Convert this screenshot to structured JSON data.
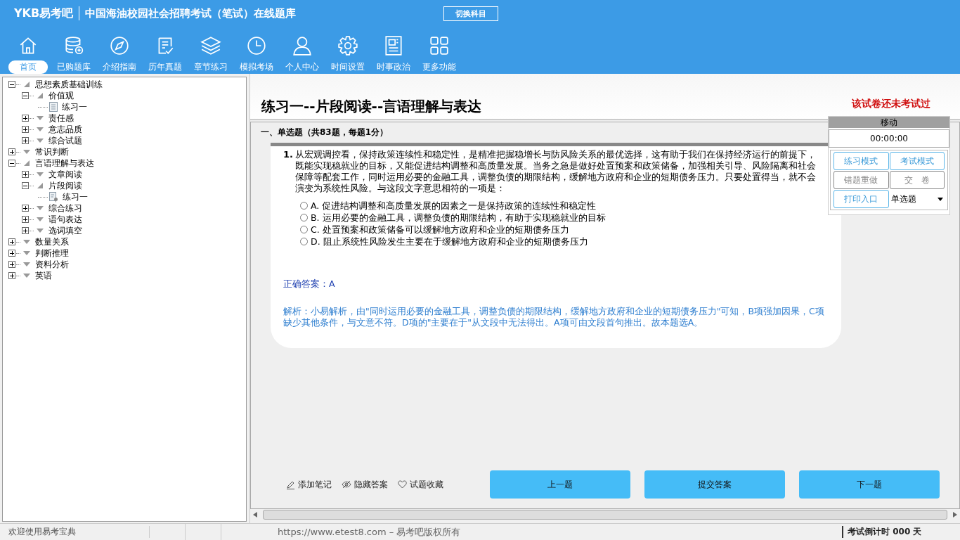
{
  "header": {
    "logo": "YKB易考吧",
    "title": "中国海油校园社会招聘考试（笔试）在线题库",
    "switch_button": "切换科目"
  },
  "nav": [
    {
      "label": "首页",
      "selected": true
    },
    {
      "label": "已购题库",
      "selected": false
    },
    {
      "label": "介绍指南",
      "selected": false
    },
    {
      "label": "历年真题",
      "selected": false
    },
    {
      "label": "章节练习",
      "selected": false
    },
    {
      "label": "模拟考场",
      "selected": false
    },
    {
      "label": "个人中心",
      "selected": false
    },
    {
      "label": "时间设置",
      "selected": false
    },
    {
      "label": "时事政治",
      "selected": false
    },
    {
      "label": "更多功能",
      "selected": false
    }
  ],
  "tree": [
    {
      "label": "思想素质基础训练",
      "expanded": true,
      "children": [
        {
          "label": "价值观",
          "expanded": true,
          "children": [
            {
              "label": "练习一",
              "kind": "doc"
            }
          ]
        },
        {
          "label": "责任感",
          "expanded": false
        },
        {
          "label": "意志品质",
          "expanded": false
        },
        {
          "label": "综合试题",
          "expanded": false
        }
      ]
    },
    {
      "label": "常识判断",
      "expanded": false
    },
    {
      "label": "言语理解与表达",
      "expanded": true,
      "children": [
        {
          "label": "文章阅读",
          "expanded": false
        },
        {
          "label": "片段阅读",
          "expanded": true,
          "children": [
            {
              "label": "练习一",
              "kind": "doc-marked"
            }
          ]
        },
        {
          "label": "综合练习",
          "expanded": false
        },
        {
          "label": "语句表达",
          "expanded": false
        },
        {
          "label": "选词填空",
          "expanded": false
        }
      ]
    },
    {
      "label": "数量关系",
      "expanded": false
    },
    {
      "label": "判断推理",
      "expanded": false
    },
    {
      "label": "资料分析",
      "expanded": false
    },
    {
      "label": "英语",
      "expanded": false
    }
  ],
  "paper": {
    "title": "练习一--片段阅读--言语理解与表达",
    "status": "该试卷还未考试过",
    "section": "一、单选题（共83题，每题1分）"
  },
  "question": {
    "number": "1.",
    "text": "从宏观调控看，保持政策连续性和稳定性，是精准把握稳增长与防风险关系的最优选择，这有助于我们在保持经济运行的前提下，既能实现稳就业的目标，又能促进结构调整和高质量发展。当务之急是做好处置预案和政策储备，加强相关引导、风险隔离和社会保障等配套工作，同时运用必要的金融工具，调整负债的期限结构，缓解地方政府和企业的短期债务压力。只要处置得当，就不会演变为系统性风险。与这段文字意思相符的一项是：",
    "options": [
      {
        "text": "A. 促进结构调整和高质量发展的因素之一是保持政策的连续性和稳定性",
        "selected": false
      },
      {
        "text": "B. 运用必要的金融工具，调整负债的期限结构，有助于实现稳就业的目标",
        "selected": false
      },
      {
        "text": "C. 处置预案和政策储备可以缓解地方政府和企业的短期债务压力",
        "selected": false
      },
      {
        "text": "D. 阻止系统性风险发生主要在于缓解地方政府和企业的短期债务压力",
        "selected": false
      }
    ],
    "answer": "正确答案：A",
    "analysis": "解析：小易解析，由\"同时运用必要的金融工具，调整负债的期限结构，缓解地方政府和企业的短期债务压力\"可知，B项强加因果，C项缺少其他条件，与文意不符。D项的\"主要在于\"从文段中无法得出。A项可由文段首句推出。故本题选A。"
  },
  "tools": [
    "添加笔记",
    "隐藏答案",
    "试题收藏"
  ],
  "buttons": [
    "上一题",
    "提交答案",
    "下一题"
  ],
  "panel": {
    "title": "移动",
    "timer": "00:00:00",
    "buttons": [
      "练习模式",
      "考试模式",
      "错题重做",
      "交　卷",
      "打印入口"
    ],
    "select": "单选题"
  },
  "status_bar": {
    "welcome": "欢迎使用易考宝典",
    "copyright": "https://www.etest8.com – 易考吧版权所有",
    "countdown": "考试倒计时 000 天"
  }
}
